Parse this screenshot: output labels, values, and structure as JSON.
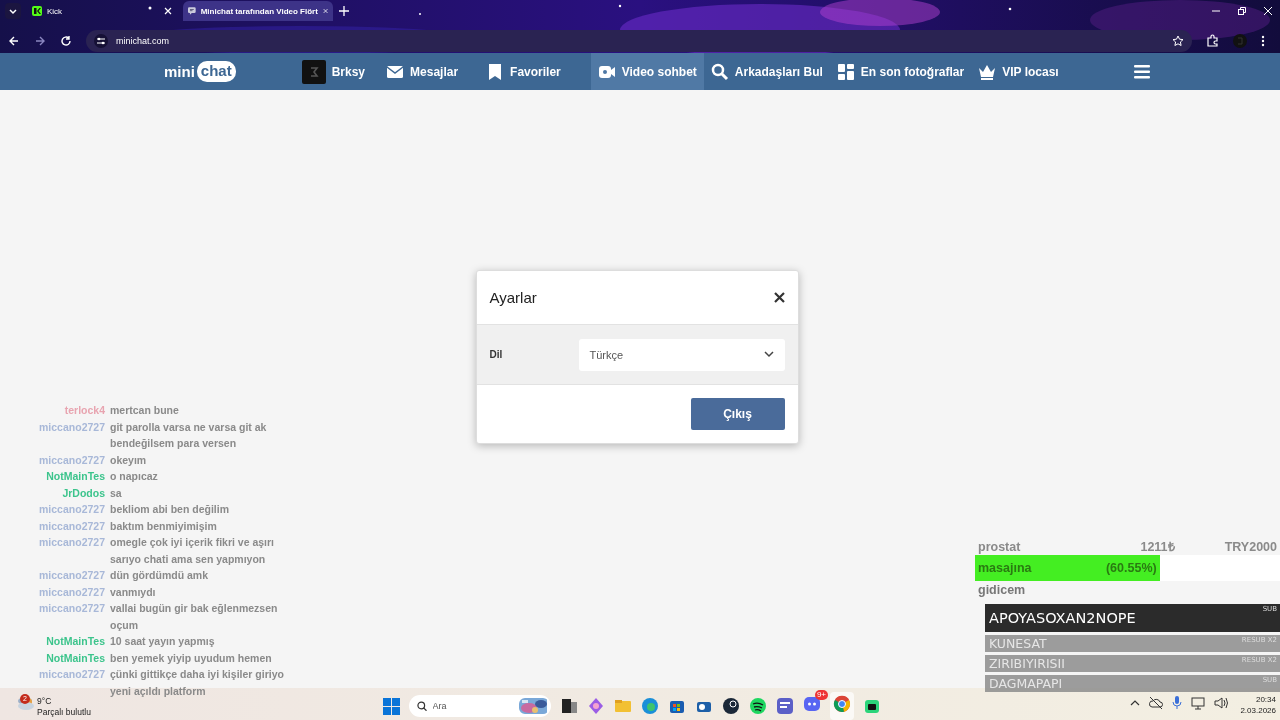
{
  "browser": {
    "tabs": [
      {
        "title": "Kick",
        "selected": false
      },
      {
        "title": "Minichat tarafından Video Flört",
        "selected": true
      }
    ],
    "address": "minichat.com"
  },
  "site_nav": {
    "logo": [
      "mini",
      "chat"
    ],
    "user": "Brksy",
    "items": [
      {
        "label": "Mesajlar",
        "selected": false
      },
      {
        "label": "Favoriler",
        "selected": false
      },
      {
        "label": "Video sohbet",
        "selected": true
      },
      {
        "label": "Arkadaşları Bul",
        "selected": false
      },
      {
        "label": "En son fotoğraflar",
        "selected": false
      },
      {
        "label": "VIP locası",
        "selected": false
      }
    ]
  },
  "dialog": {
    "title": "Ayarlar",
    "field_label": "Dil",
    "select_value": "Türkçe",
    "button": "Çıkış"
  },
  "stream_chat": {
    "messages": [
      {
        "user": "terlock4",
        "color": "#e8a4b0",
        "text": "mertcan bune"
      },
      {
        "user": "miccano2727",
        "color": "#a8b8d8",
        "text": "git parolla varsa ne varsa git ak bendeğilsem para versen"
      },
      {
        "user": "miccano2727",
        "color": "#a8b8d8",
        "text": "okeyım"
      },
      {
        "user": "NotMainTes",
        "color": "#3cc48c",
        "text": "o napıcaz"
      },
      {
        "user": "JrDodos",
        "color": "#3cc48c",
        "text": "sa"
      },
      {
        "user": "miccano2727",
        "color": "#a8b8d8",
        "text": "bekliom abi ben değilim"
      },
      {
        "user": "miccano2727",
        "color": "#a8b8d8",
        "text": "baktım benmiyimişim"
      },
      {
        "user": "miccano2727",
        "color": "#a8b8d8",
        "text": "omegle çok iyi içerik fikri ve aşırı sarıyo chati ama sen yapmıyon"
      },
      {
        "user": "miccano2727",
        "color": "#a8b8d8",
        "text": "dün gördümdü amk"
      },
      {
        "user": "miccano2727",
        "color": "#a8b8d8",
        "text": "vanmıydı"
      },
      {
        "user": "miccano2727",
        "color": "#a8b8d8",
        "text": "vallai bugün gir bak eğlenmezsen oçum"
      },
      {
        "user": "NotMainTes",
        "color": "#3cc48c",
        "text": "10 saat yayın yapmış"
      },
      {
        "user": "NotMainTes",
        "color": "#3cc48c",
        "text": "ben yemek yiyip uyudum hemen"
      },
      {
        "user": "miccano2727",
        "color": "#a8b8d8",
        "text": "çünki gittikçe daha iyi kişiler giriyo yeni açıldı platform"
      }
    ]
  },
  "donation_goal": {
    "title_words": [
      "prostat",
      "masajına",
      "gidicem"
    ],
    "amount": "1211₺",
    "target": "TRY2000",
    "percent": "(60.55%)",
    "level": 0.6055
  },
  "subs": [
    {
      "name": "APOYASOXAN2NOPE",
      "label": "SUB",
      "kind": "latest"
    },
    {
      "name": "KUNESAT",
      "label": "RESUB X2",
      "kind": "older"
    },
    {
      "name": "ZIRIBIYIRISII",
      "label": "RESUB X2",
      "kind": "older"
    },
    {
      "name": "DAGMAPAPI",
      "label": "SUB",
      "kind": "older"
    }
  ],
  "taskbar": {
    "search_placeholder": "Ara",
    "weather": {
      "badge": "2",
      "temperature": "9°C",
      "condition": "Parçalı bulutlu"
    },
    "app_badge": "9+",
    "time": "20:34",
    "date": "2.03.2026"
  }
}
